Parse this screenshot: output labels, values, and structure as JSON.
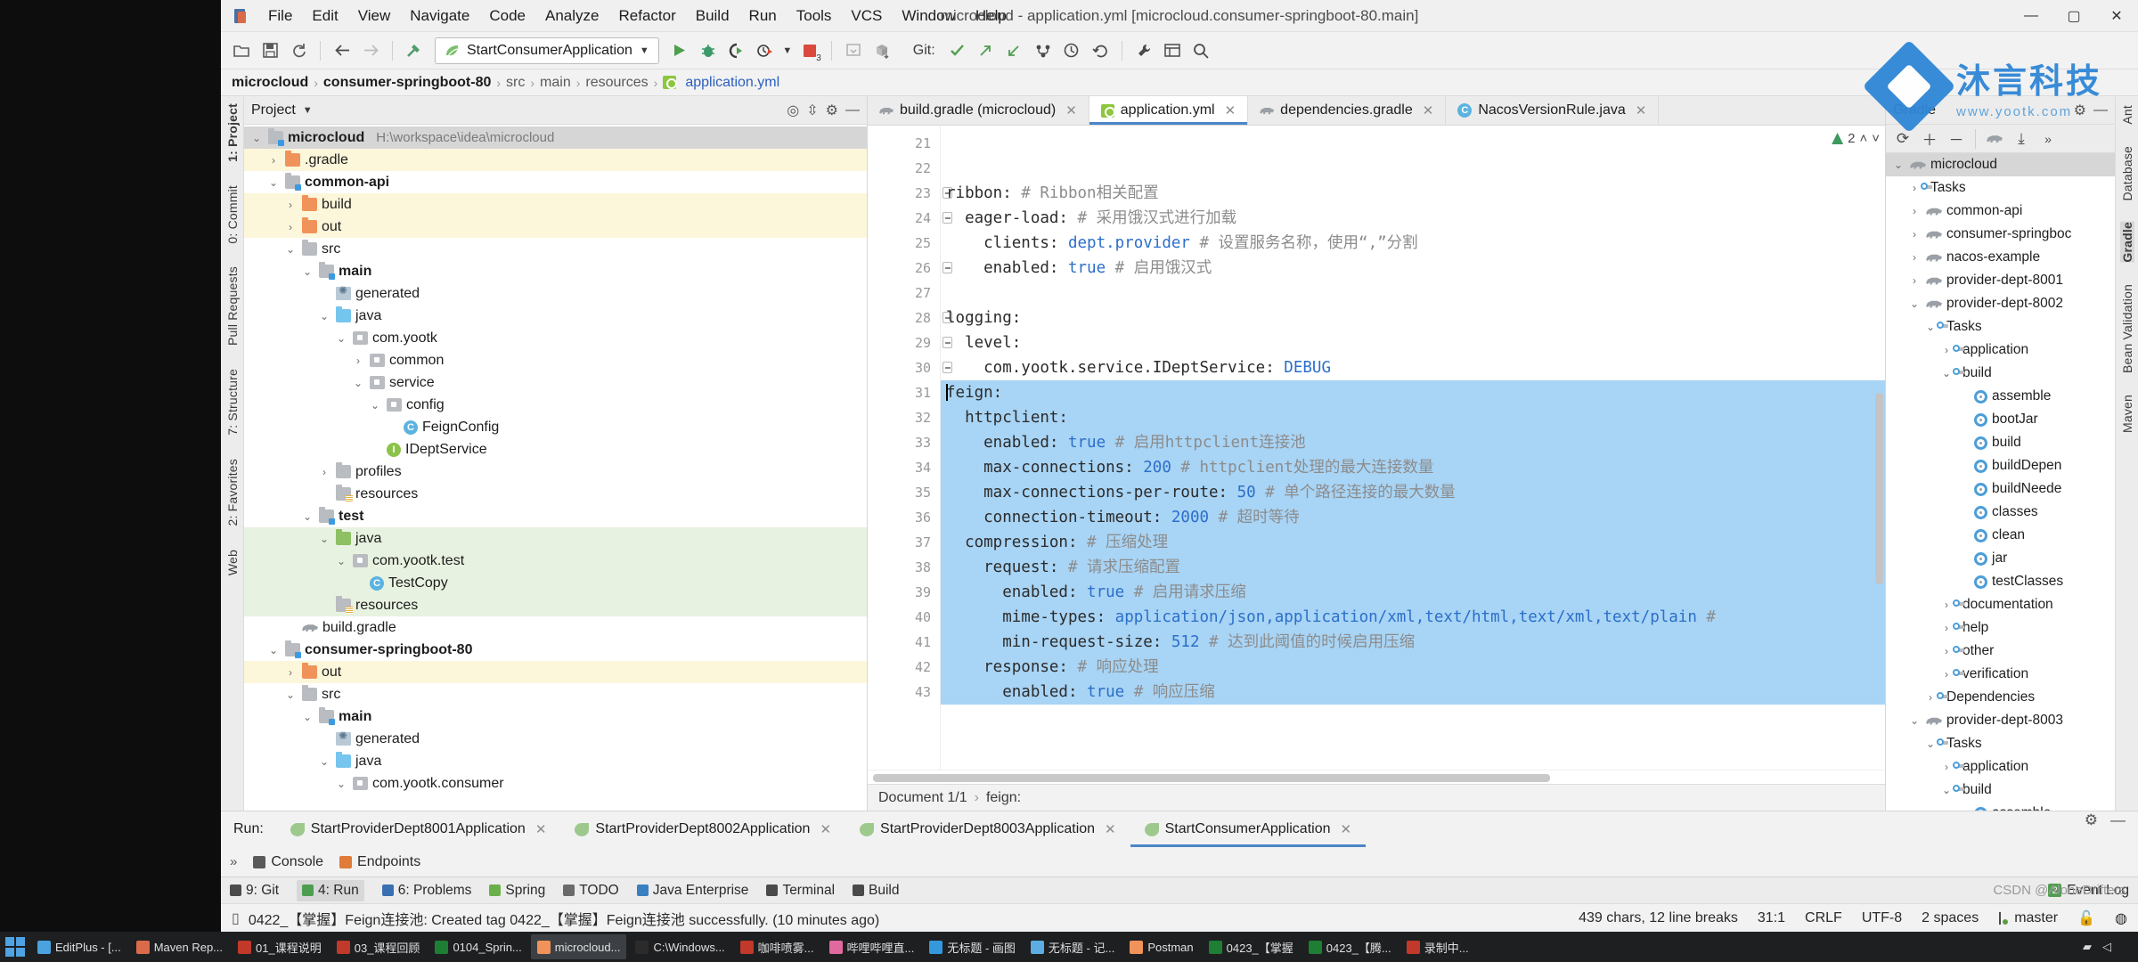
{
  "window": {
    "title": "microcloud - application.yml [microcloud.consumer-springboot-80.main]",
    "minimize": "—",
    "maximize": "▢",
    "close": "✕"
  },
  "menu": [
    "File",
    "Edit",
    "View",
    "Navigate",
    "Code",
    "Analyze",
    "Refactor",
    "Build",
    "Run",
    "Tools",
    "VCS",
    "Window",
    "Help"
  ],
  "toolbar": {
    "git_label": "Git:",
    "run_config": "StartConsumerApplication",
    "stop_badge": "3"
  },
  "breadcrumb": [
    "microcloud",
    "consumer-springboot-80",
    "src",
    "main",
    "resources",
    "application.yml"
  ],
  "project_panel": {
    "title": "Project",
    "tree": [
      {
        "depth": 0,
        "arrow": "v",
        "icon": "module",
        "label": "microcloud",
        "bold": true,
        "path": "H:\\workspace\\idea\\microcloud",
        "state": "selected"
      },
      {
        "depth": 1,
        "arrow": ">",
        "icon": "folder-orange",
        "label": ".gradle",
        "state": "yellow"
      },
      {
        "depth": 1,
        "arrow": "v",
        "icon": "module",
        "label": "common-api",
        "bold": true
      },
      {
        "depth": 2,
        "arrow": ">",
        "icon": "folder-orange",
        "label": "build",
        "state": "yellow"
      },
      {
        "depth": 2,
        "arrow": ">",
        "icon": "folder-orange",
        "label": "out",
        "state": "yellow"
      },
      {
        "depth": 2,
        "arrow": "v",
        "icon": "folder-grey",
        "label": "src"
      },
      {
        "depth": 3,
        "arrow": "v",
        "icon": "module",
        "label": "main",
        "bold": true
      },
      {
        "depth": 4,
        "arrow": "",
        "icon": "generated",
        "label": "generated"
      },
      {
        "depth": 4,
        "arrow": "v",
        "icon": "folder-blue",
        "label": "java"
      },
      {
        "depth": 5,
        "arrow": "v",
        "icon": "package",
        "label": "com.yootk"
      },
      {
        "depth": 6,
        "arrow": ">",
        "icon": "package",
        "label": "common"
      },
      {
        "depth": 6,
        "arrow": "v",
        "icon": "package",
        "label": "service"
      },
      {
        "depth": 7,
        "arrow": "v",
        "icon": "package",
        "label": "config"
      },
      {
        "depth": 8,
        "arrow": "",
        "icon": "class",
        "label": "FeignConfig"
      },
      {
        "depth": 7,
        "arrow": "",
        "icon": "interface",
        "label": "IDeptService"
      },
      {
        "depth": 4,
        "arrow": ">",
        "icon": "folder-grey",
        "label": "profiles"
      },
      {
        "depth": 4,
        "arrow": "",
        "icon": "resources",
        "label": "resources"
      },
      {
        "depth": 3,
        "arrow": "v",
        "icon": "module",
        "label": "test",
        "bold": true
      },
      {
        "depth": 4,
        "arrow": "v",
        "icon": "folder-green",
        "label": "java",
        "state": "green"
      },
      {
        "depth": 5,
        "arrow": "v",
        "icon": "package",
        "label": "com.yootk.test",
        "state": "green"
      },
      {
        "depth": 6,
        "arrow": "",
        "icon": "class",
        "label": "TestCopy",
        "state": "green"
      },
      {
        "depth": 4,
        "arrow": "",
        "icon": "resources-test",
        "label": "resources",
        "state": "green"
      },
      {
        "depth": 2,
        "arrow": "",
        "icon": "gradle",
        "label": "build.gradle"
      },
      {
        "depth": 1,
        "arrow": "v",
        "icon": "module",
        "label": "consumer-springboot-80",
        "bold": true
      },
      {
        "depth": 2,
        "arrow": ">",
        "icon": "folder-orange",
        "label": "out",
        "state": "yellow"
      },
      {
        "depth": 2,
        "arrow": "v",
        "icon": "folder-grey",
        "label": "src"
      },
      {
        "depth": 3,
        "arrow": "v",
        "icon": "module",
        "label": "main",
        "bold": true
      },
      {
        "depth": 4,
        "arrow": "",
        "icon": "generated",
        "label": "generated"
      },
      {
        "depth": 4,
        "arrow": "v",
        "icon": "folder-blue",
        "label": "java"
      },
      {
        "depth": 5,
        "arrow": "v",
        "icon": "package",
        "label": "com.yootk.consumer"
      }
    ]
  },
  "left_strip": [
    "1: Project",
    "0: Commit",
    "Pull Requests",
    "7: Structure",
    "2: Favorites",
    "Web"
  ],
  "right_strip": [
    "Ant",
    "Database",
    "Gradle",
    "Bean Validation",
    "Maven"
  ],
  "editor": {
    "tabs": [
      {
        "label": "build.gradle (microcloud)",
        "icon": "gradle-icon",
        "active": false,
        "close": "✕"
      },
      {
        "label": "application.yml",
        "icon": "yml-icon",
        "active": true,
        "close": "✕"
      },
      {
        "label": "dependencies.gradle",
        "icon": "gradle-icon",
        "active": false,
        "close": "✕"
      },
      {
        "label": "NacosVersionRule.java",
        "icon": "java-icon",
        "active": false,
        "close": "✕"
      }
    ],
    "inspection_count": "2",
    "first_line_number": 21,
    "lines": [
      {
        "n": 21,
        "text": "",
        "selected": false
      },
      {
        "n": 22,
        "text": "",
        "selected": false
      },
      {
        "n": 23,
        "text": "ribbon: # Ribbon相关配置",
        "selected": false,
        "fold": true
      },
      {
        "n": 24,
        "text": "  eager-load: # 采用饿汉式进行加载",
        "selected": false,
        "fold": true
      },
      {
        "n": 25,
        "text": "    clients: dept.provider # 设置服务名称，使用“,”分割",
        "selected": false
      },
      {
        "n": 26,
        "text": "    enabled: true # 启用饿汉式",
        "selected": false,
        "fold": true
      },
      {
        "n": 27,
        "text": "",
        "selected": false
      },
      {
        "n": 28,
        "text": "logging:",
        "selected": false,
        "fold": true
      },
      {
        "n": 29,
        "text": "  level:",
        "selected": false,
        "fold": true
      },
      {
        "n": 30,
        "text": "    com.yootk.service.IDeptService: DEBUG",
        "selected": false,
        "fold": true
      },
      {
        "n": 31,
        "text": "feign:",
        "selected": true,
        "fold": true,
        "caret": true
      },
      {
        "n": 32,
        "text": "  httpclient:",
        "selected": true,
        "fold": true
      },
      {
        "n": 33,
        "text": "    enabled: true # 启用httpclient连接池",
        "selected": true
      },
      {
        "n": 34,
        "text": "    max-connections: 200 # httpclient处理的最大连接数量",
        "selected": true
      },
      {
        "n": 35,
        "text": "    max-connections-per-route: 50 # 单个路径连接的最大数量",
        "selected": true
      },
      {
        "n": 36,
        "text": "    connection-timeout: 2000 # 超时等待",
        "selected": true,
        "fold": true
      },
      {
        "n": 37,
        "text": "  compression: # 压缩处理",
        "selected": true,
        "fold": true
      },
      {
        "n": 38,
        "text": "    request: # 请求压缩配置",
        "selected": true,
        "fold": true
      },
      {
        "n": 39,
        "text": "      enabled: true # 启用请求压缩",
        "selected": true
      },
      {
        "n": 40,
        "text": "      mime-types: application/json,application/xml,text/html,text/xml,text/plain #",
        "selected": true
      },
      {
        "n": 41,
        "text": "      min-request-size: 512 # 达到此阈值的时候启用压缩",
        "selected": true,
        "fold": true
      },
      {
        "n": 42,
        "text": "    response: # 响应处理",
        "selected": true,
        "fold": true
      },
      {
        "n": 43,
        "text": "      enabled: true # 响应压缩",
        "selected": true
      }
    ],
    "doc_status": "Document 1/1",
    "doc_path": "feign:"
  },
  "gradle_panel": {
    "title": "Gradle",
    "tree": [
      {
        "depth": 0,
        "arrow": "v",
        "icon": "gradle",
        "label": "microcloud",
        "state": "selected"
      },
      {
        "depth": 1,
        "arrow": ">",
        "icon": "tasks",
        "label": "Tasks"
      },
      {
        "depth": 1,
        "arrow": ">",
        "icon": "gradle",
        "label": "common-api"
      },
      {
        "depth": 1,
        "arrow": ">",
        "icon": "gradle",
        "label": "consumer-springboc"
      },
      {
        "depth": 1,
        "arrow": ">",
        "icon": "gradle",
        "label": "nacos-example"
      },
      {
        "depth": 1,
        "arrow": ">",
        "icon": "gradle",
        "label": "provider-dept-8001"
      },
      {
        "depth": 1,
        "arrow": "v",
        "icon": "gradle",
        "label": "provider-dept-8002"
      },
      {
        "depth": 2,
        "arrow": "v",
        "icon": "tasks",
        "label": "Tasks"
      },
      {
        "depth": 3,
        "arrow": ">",
        "icon": "tasks",
        "label": "application"
      },
      {
        "depth": 3,
        "arrow": "v",
        "icon": "tasks",
        "label": "build"
      },
      {
        "depth": 4,
        "arrow": "",
        "icon": "gear",
        "label": "assemble"
      },
      {
        "depth": 4,
        "arrow": "",
        "icon": "gear",
        "label": "bootJar"
      },
      {
        "depth": 4,
        "arrow": "",
        "icon": "gear",
        "label": "build"
      },
      {
        "depth": 4,
        "arrow": "",
        "icon": "gear",
        "label": "buildDepen"
      },
      {
        "depth": 4,
        "arrow": "",
        "icon": "gear",
        "label": "buildNeede"
      },
      {
        "depth": 4,
        "arrow": "",
        "icon": "gear",
        "label": "classes"
      },
      {
        "depth": 4,
        "arrow": "",
        "icon": "gear",
        "label": "clean"
      },
      {
        "depth": 4,
        "arrow": "",
        "icon": "gear",
        "label": "jar"
      },
      {
        "depth": 4,
        "arrow": "",
        "icon": "gear",
        "label": "testClasses"
      },
      {
        "depth": 3,
        "arrow": ">",
        "icon": "tasks",
        "label": "documentation"
      },
      {
        "depth": 3,
        "arrow": ">",
        "icon": "tasks",
        "label": "help"
      },
      {
        "depth": 3,
        "arrow": ">",
        "icon": "tasks",
        "label": "other"
      },
      {
        "depth": 3,
        "arrow": ">",
        "icon": "tasks",
        "label": "verification"
      },
      {
        "depth": 2,
        "arrow": ">",
        "icon": "tasks",
        "label": "Dependencies"
      },
      {
        "depth": 1,
        "arrow": "v",
        "icon": "gradle",
        "label": "provider-dept-8003"
      },
      {
        "depth": 2,
        "arrow": "v",
        "icon": "tasks",
        "label": "Tasks"
      },
      {
        "depth": 3,
        "arrow": ">",
        "icon": "tasks",
        "label": "application"
      },
      {
        "depth": 3,
        "arrow": "v",
        "icon": "tasks",
        "label": "build"
      },
      {
        "depth": 4,
        "arrow": "",
        "icon": "gear",
        "label": "assemble"
      }
    ]
  },
  "run_window": {
    "label": "Run:",
    "tabs": [
      {
        "label": "StartProviderDept8001Application",
        "active": false,
        "close": "✕"
      },
      {
        "label": "StartProviderDept8002Application",
        "active": false,
        "close": "✕"
      },
      {
        "label": "StartProviderDept8003Application",
        "active": false,
        "close": "✕"
      },
      {
        "label": "StartConsumerApplication",
        "active": true,
        "close": "✕"
      }
    ],
    "sub_tabs": [
      "Console",
      "Endpoints"
    ]
  },
  "bottom_bar": {
    "items": [
      "9: Git",
      "4: Run",
      "6: Problems",
      "Spring",
      "TODO",
      "Java Enterprise",
      "Terminal",
      "Build"
    ],
    "active": "4: Run",
    "event_log": "Event Log",
    "event_badge": "2"
  },
  "status_bar": {
    "message": "0422_【掌握】Feign连接池: Created tag 0422_【掌握】Feign连接池 successfully. (10 minutes ago)",
    "chars": "439 chars, 12 line breaks",
    "caret": "31:1",
    "line_sep": "CRLF",
    "encoding": "UTF-8",
    "indent": "2 spaces",
    "branch": "master"
  },
  "logo": {
    "title": "沐言科技",
    "subtitle": "www.yootk.com"
  },
  "watermark": "CSDN @AloneDrifters",
  "taskbar": {
    "items": [
      {
        "label": "EditPlus - [...",
        "color": "#4aa3df"
      },
      {
        "label": "Maven Rep...",
        "color": "#d96a4a"
      },
      {
        "label": "01_课程说明",
        "color": "#c0392b"
      },
      {
        "label": "03_课程回顾",
        "color": "#c0392b"
      },
      {
        "label": "0104_Sprin...",
        "color": "#1e7e34"
      },
      {
        "label": "microcloud...",
        "color": "#f0935a",
        "active": true
      },
      {
        "label": "C:\\Windows...",
        "color": "#2b2b2b"
      },
      {
        "label": "咖啡喷雾...",
        "color": "#c0392b"
      },
      {
        "label": "哔哩哔哩直...",
        "color": "#e06aa0"
      },
      {
        "label": "无标题 - 画图",
        "color": "#3498db"
      },
      {
        "label": "无标题 - 记...",
        "color": "#5dade2"
      },
      {
        "label": "Postman",
        "color": "#f0935a"
      },
      {
        "label": "0423_【掌握",
        "color": "#1e7e34"
      },
      {
        "label": "0423_【腾...",
        "color": "#1e7e34"
      },
      {
        "label": "录制中...",
        "color": "#c0392b"
      }
    ],
    "time": ""
  }
}
